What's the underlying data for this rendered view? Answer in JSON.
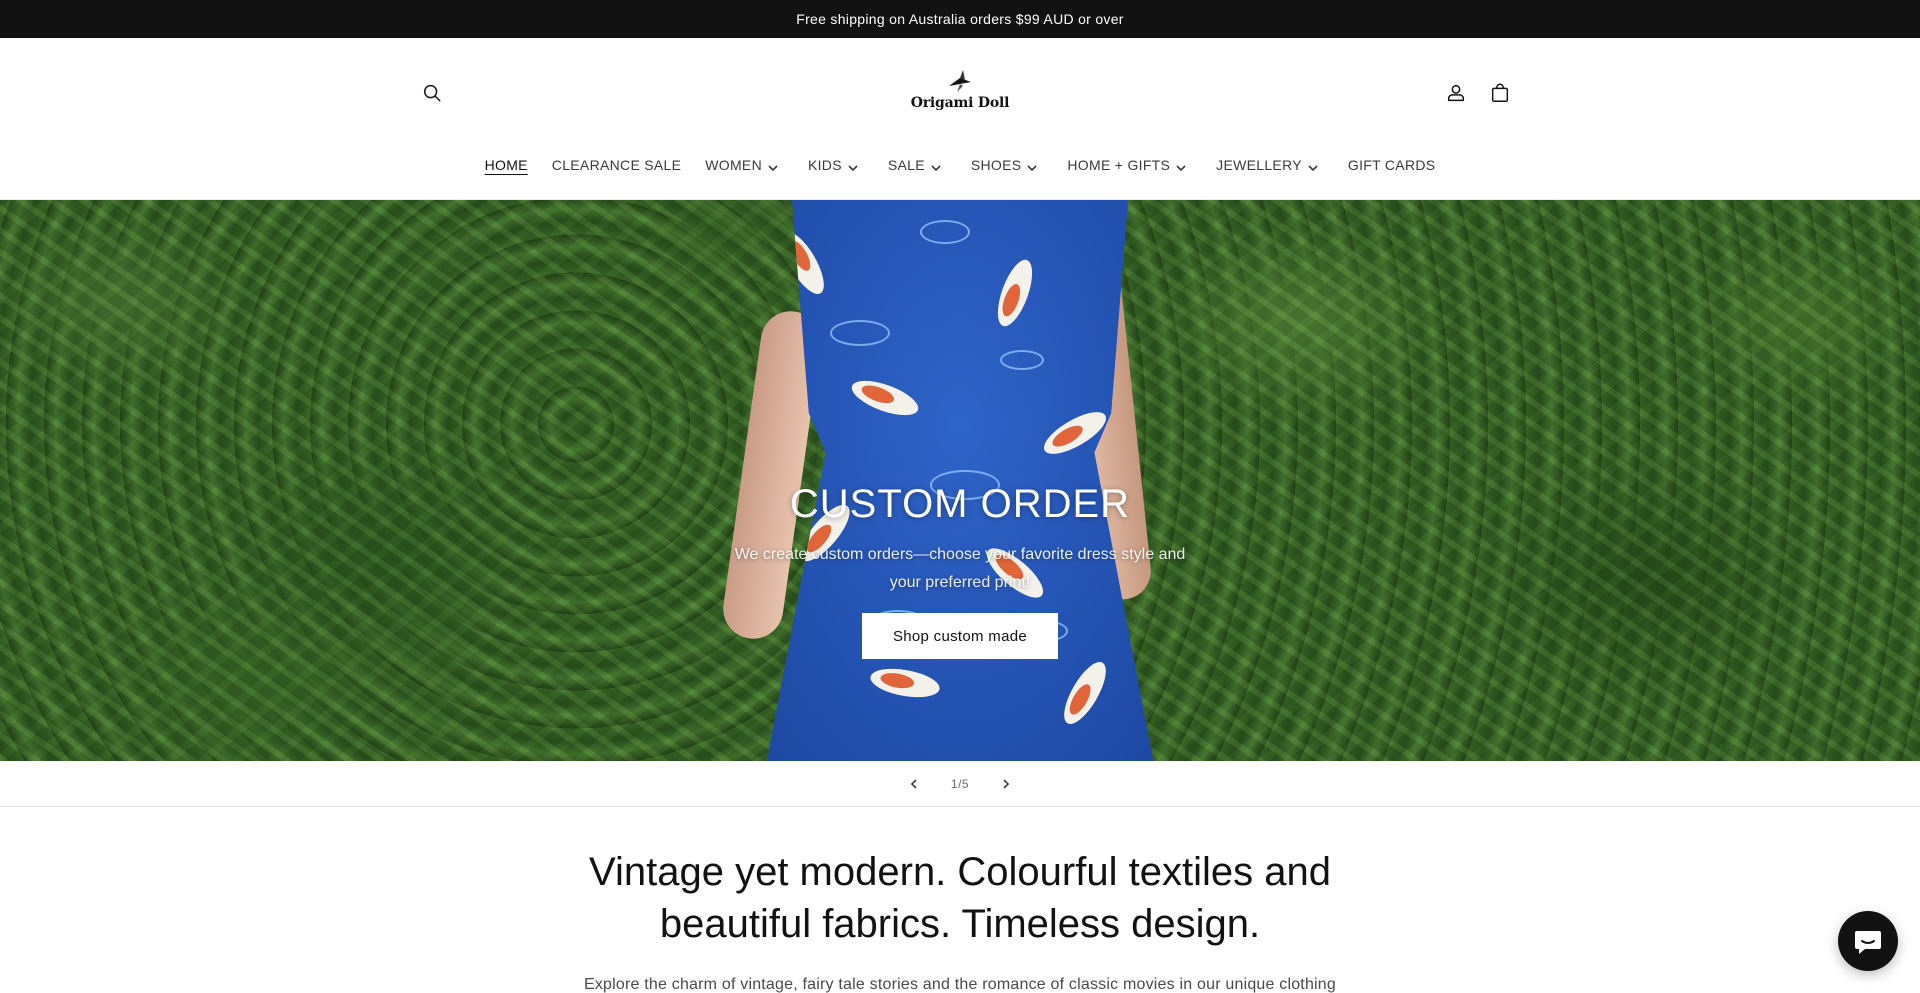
{
  "announcement": {
    "text": "Free shipping on Australia orders $99 AUD or over"
  },
  "header": {
    "logo_text": "Origami Doll",
    "nav": [
      {
        "label": "HOME",
        "active": true,
        "dropdown": false
      },
      {
        "label": "CLEARANCE SALE",
        "active": false,
        "dropdown": false
      },
      {
        "label": "WOMEN",
        "active": false,
        "dropdown": true
      },
      {
        "label": "KIDS",
        "active": false,
        "dropdown": true
      },
      {
        "label": "SALE",
        "active": false,
        "dropdown": true
      },
      {
        "label": "SHOES",
        "active": false,
        "dropdown": true
      },
      {
        "label": "HOME + GIFTS",
        "active": false,
        "dropdown": true
      },
      {
        "label": "JEWELLERY",
        "active": false,
        "dropdown": true
      },
      {
        "label": "GIFT CARDS",
        "active": false,
        "dropdown": false
      }
    ],
    "icons": {
      "search": "search-icon",
      "account": "user-icon",
      "cart": "bag-icon"
    }
  },
  "hero": {
    "title": "CUSTOM ORDER",
    "subtitle": "We create custom orders—choose your favorite dress style and your preferred print!",
    "button_label": "Shop custom made"
  },
  "slideshow": {
    "counter": "1/5",
    "current": 1,
    "total": 5
  },
  "intro": {
    "heading": "Vintage yet modern. Colourful textiles and beautiful fabrics. Timeless design.",
    "body": "Explore the charm of vintage, fairy tale stories and the romance of classic movies in our unique clothing"
  },
  "colors": {
    "announcement_bg": "#121212",
    "dress_blue": "#2555b5",
    "foliage_green": "#355f24",
    "chat_bg": "#121212"
  }
}
